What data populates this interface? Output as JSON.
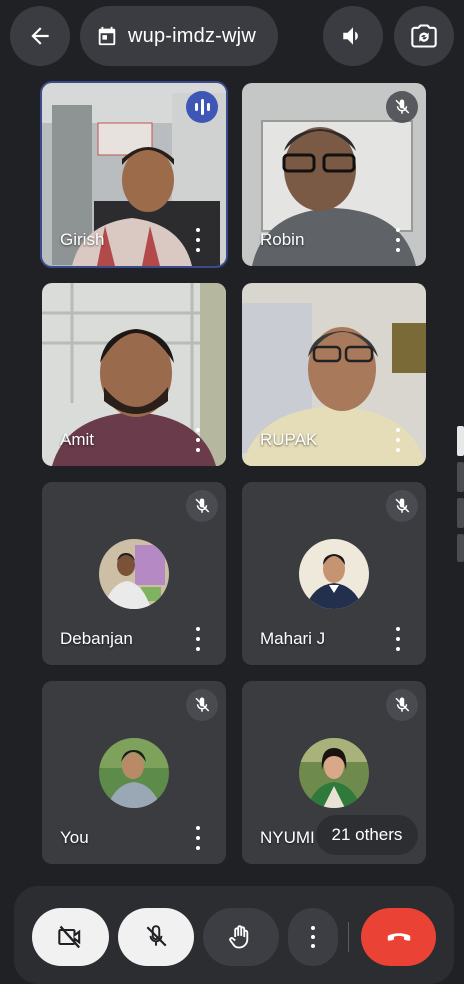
{
  "meeting": {
    "code": "wup-imdz-wjw"
  },
  "participants": [
    {
      "name": "Girish"
    },
    {
      "name": "Robin"
    },
    {
      "name": "Amit"
    },
    {
      "name": "RUPAK"
    },
    {
      "name": "Debanjan"
    },
    {
      "name": "Mahari J"
    },
    {
      "name": "You"
    },
    {
      "name": "NYUMI"
    }
  ],
  "others_label": "21 others",
  "colors": {
    "background": "#1f2125",
    "tile": "#3a3c40",
    "speaking_outline": "#3b4a8c",
    "end_call": "#ea4335"
  },
  "icons": {
    "back": "back-arrow-icon",
    "calendar": "calendar-icon",
    "speaker": "speaker-icon",
    "switch_camera": "switch-camera-icon",
    "camera_off": "camera-off-icon",
    "mic_off": "mic-off-icon",
    "raise_hand": "raise-hand-icon",
    "more": "more-vert-icon",
    "end_call": "end-call-icon"
  }
}
